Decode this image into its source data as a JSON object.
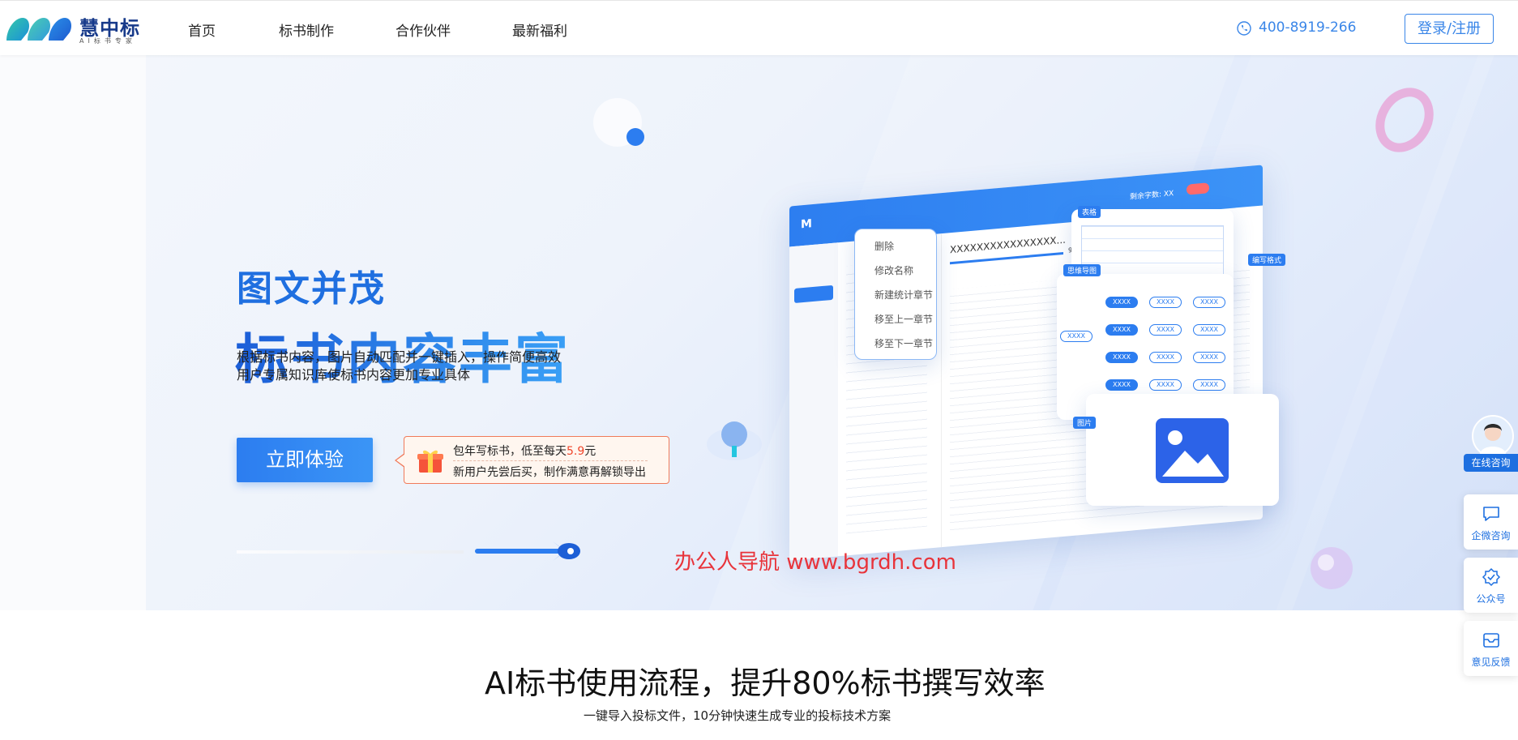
{
  "header": {
    "logo_text": "慧中标",
    "logo_sub": "AI标书专家",
    "nav": [
      "首页",
      "标书制作",
      "合作伙伴",
      "最新福利"
    ],
    "phone": "400-8919-266",
    "login": "登录/注册"
  },
  "hero": {
    "title_line1": "图文并茂",
    "title_line2": "标书内容丰富",
    "desc_line1": "根据标书内容，图片自动匹配并一键插入，操作简便高效",
    "desc_line2": "用户专属知识库使标书内容更加专业具体",
    "cta": "立即体验",
    "promo": {
      "line1_prefix": "包年写标书，低至每天",
      "line1_price": "5.9",
      "line1_suffix": "元",
      "line2": "新用户先尝后买，制作满意再解锁导出"
    },
    "watermark": "办公人导航  www.bgrdh.com"
  },
  "mockup": {
    "word_count": "剩余字数: XX",
    "doc_title": "XXXXXXXXXXXXXXXX...",
    "context_menu": [
      "删除",
      "修改名称",
      "新建统计章节",
      "移至上一章节",
      "移至下一章节"
    ],
    "tags": {
      "table": "表格",
      "mindmap": "思维导图",
      "image": "图片",
      "format": "编写格式"
    },
    "node": "XXXX",
    "progress": "90%"
  },
  "sidebar": {
    "online": "在线咨询",
    "wecom": "企微咨询",
    "official": "公众号",
    "feedback": "意见反馈"
  },
  "section": {
    "title": "AI标书使用流程，提升80%标书撰写效率",
    "subtitle": "一键导入投标文件，10分钟快速生成专业的投标技术方案"
  },
  "colors": {
    "brand": "#2c7df0",
    "navy": "#173a8a",
    "price": "#f0452a",
    "watermark": "#e8333a"
  }
}
